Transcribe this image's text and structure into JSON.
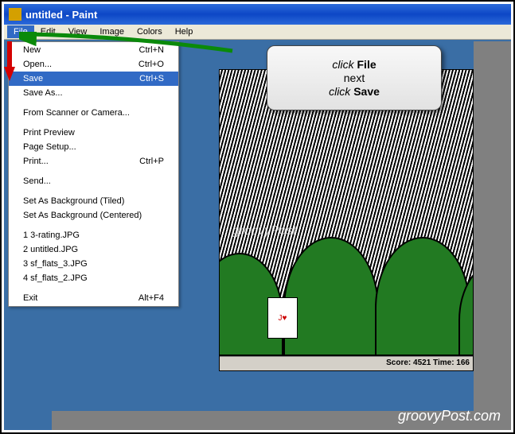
{
  "title": "untitled - Paint",
  "menubar": {
    "file": "File",
    "edit": "Edit",
    "view": "View",
    "image": "Image",
    "colors": "Colors",
    "help": "Help"
  },
  "menu": {
    "new": {
      "label": "New",
      "accel": "Ctrl+N"
    },
    "open": {
      "label": "Open...",
      "accel": "Ctrl+O"
    },
    "save": {
      "label": "Save",
      "accel": "Ctrl+S"
    },
    "saveas": {
      "label": "Save As..."
    },
    "scanner": {
      "label": "From Scanner or Camera..."
    },
    "preview": {
      "label": "Print Preview"
    },
    "pagesetup": {
      "label": "Page Setup..."
    },
    "print": {
      "label": "Print...",
      "accel": "Ctrl+P"
    },
    "send": {
      "label": "Send..."
    },
    "bgtiled": {
      "label": "Set As Background (Tiled)"
    },
    "bgcenter": {
      "label": "Set As Background (Centered)"
    },
    "r1": {
      "label": "1 3-rating.JPG"
    },
    "r2": {
      "label": "2 untitled.JPG"
    },
    "r3": {
      "label": "3 sf_flats_3.JPG"
    },
    "r4": {
      "label": "4 sf_flats_2.JPG"
    },
    "exit": {
      "label": "Exit",
      "accel": "Alt+F4"
    }
  },
  "callout": {
    "l1a": "click",
    "l1b": "File",
    "l2": "next",
    "l3a": "click",
    "l3b": "Save"
  },
  "game": {
    "card": "J♥",
    "status": "Score: 4521 Time: 166"
  },
  "watermark": "groovyPost",
  "brand": "groovyPost.com"
}
